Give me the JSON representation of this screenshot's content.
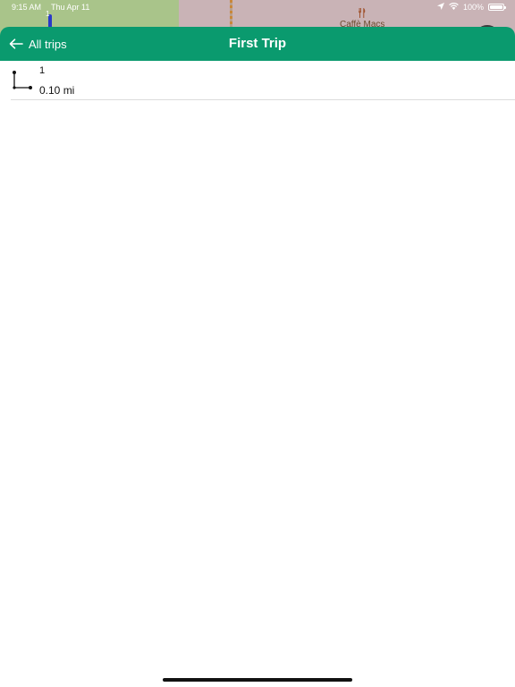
{
  "status_bar": {
    "time": "9:15 AM",
    "date": "Thu Apr 11",
    "battery": "100%",
    "icons": [
      "location-arrow-icon",
      "wifi-icon",
      "battery-icon"
    ]
  },
  "map": {
    "route_label": "1",
    "poi_label": "Caffè Macs",
    "poi_icon": "restaurant-icon"
  },
  "nav": {
    "back_label": "All trips",
    "back_icon": "arrow-left-icon",
    "title": "First Trip",
    "color": "#0a9a6e"
  },
  "segments": [
    {
      "name": "1",
      "distance": "0.10 mi",
      "icon": "route-segment-icon"
    }
  ]
}
